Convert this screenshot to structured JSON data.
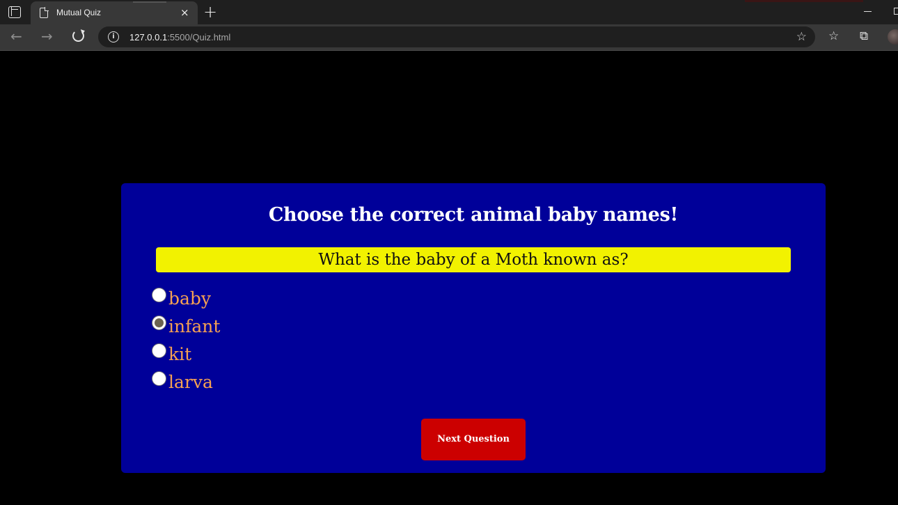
{
  "browser": {
    "tab_title": "Mutual Quiz",
    "tab_close": "×",
    "new_tab": "+",
    "url_host": "127.0.0.1",
    "url_path": ":5500/Quiz.html",
    "icons": [
      "tab-actions-icon",
      "page-icon",
      "back-arrow-icon",
      "forward-arrow-icon",
      "reload-icon",
      "info-icon",
      "add-favorite-icon",
      "favorites-icon",
      "collections-icon",
      "profile-avatar",
      "minimize-icon",
      "maximize-icon"
    ]
  },
  "quiz": {
    "title": "Choose the correct animal baby names!",
    "question": "What is the baby of a Moth known as?",
    "options": [
      {
        "label": "baby",
        "selected": false
      },
      {
        "label": "infant",
        "selected": true
      },
      {
        "label": "kit",
        "selected": false
      },
      {
        "label": "larva",
        "selected": false
      }
    ],
    "next_button": "Next Question"
  },
  "colors": {
    "page_bg": "#000000",
    "card_bg": "#000099",
    "question_bg": "#f2f200",
    "option_text": "#f5a153",
    "button_bg": "#cc0000"
  }
}
